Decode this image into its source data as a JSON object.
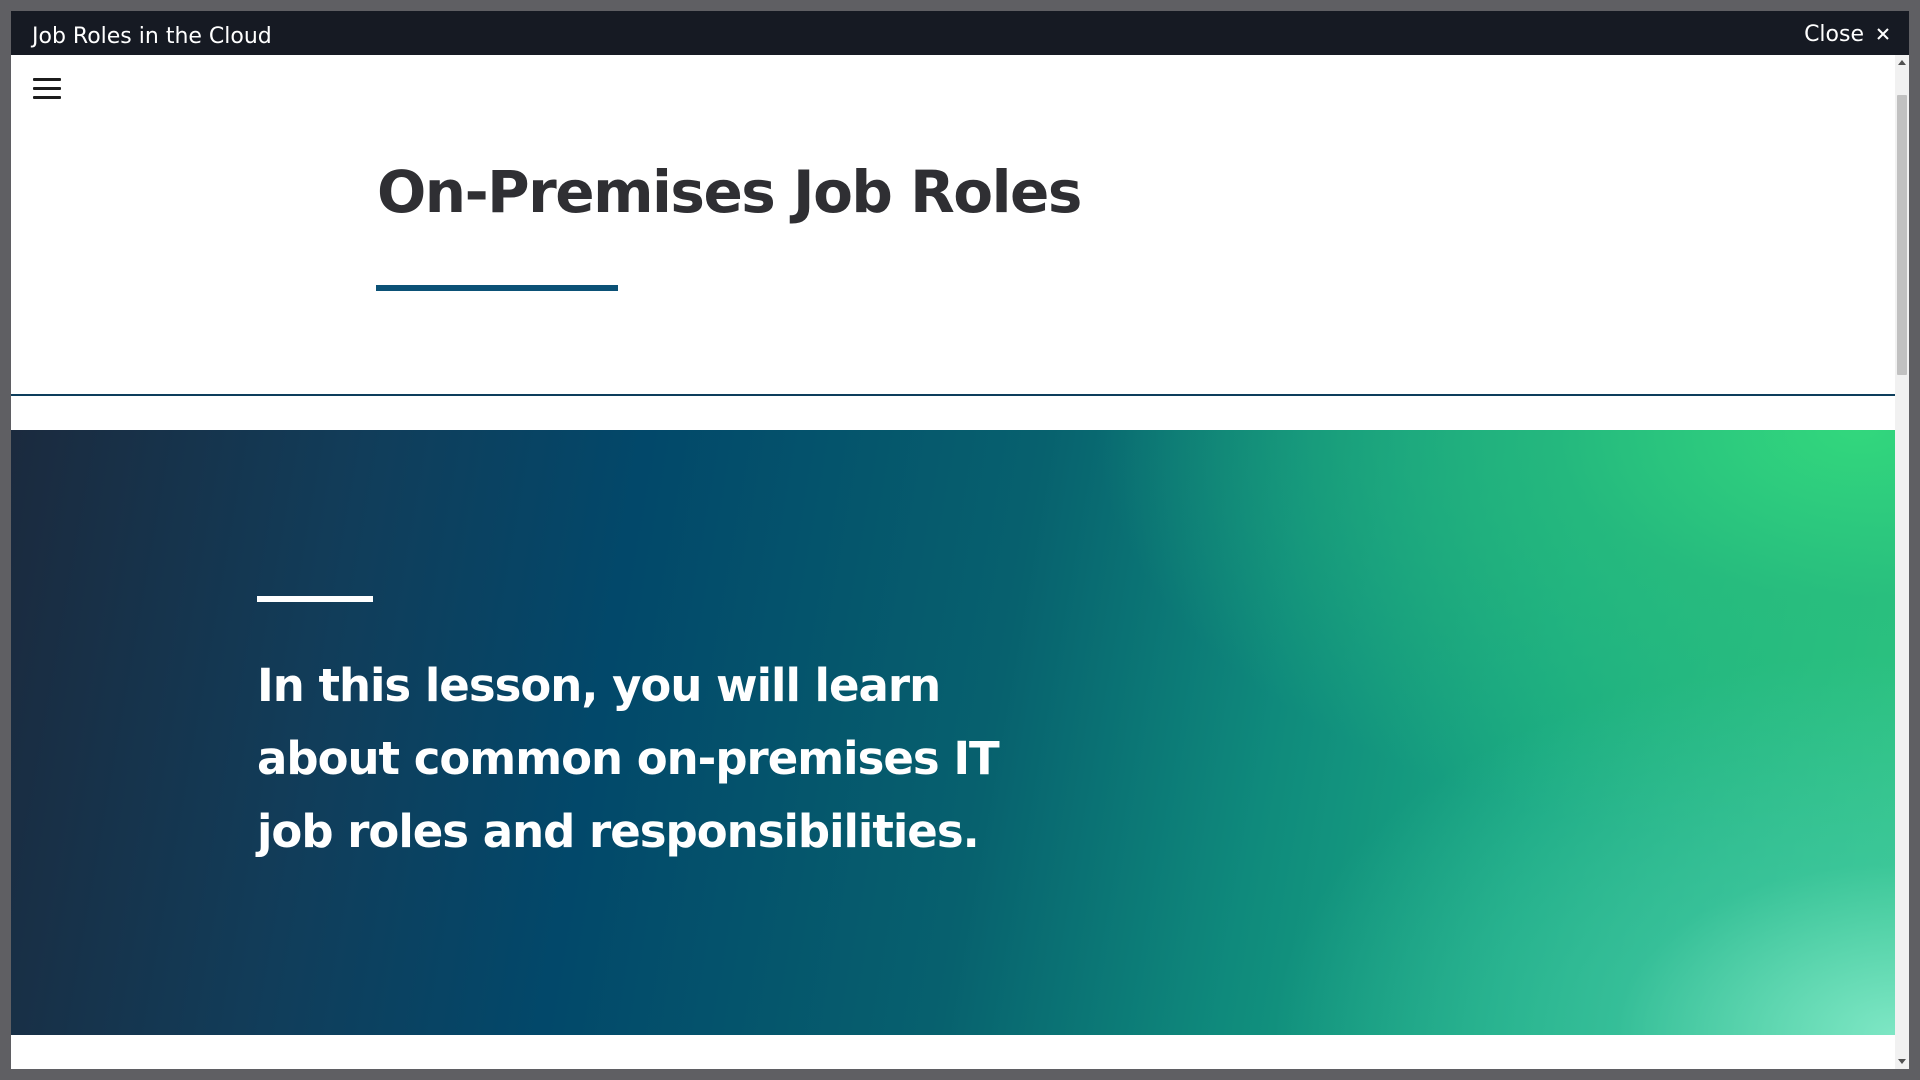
{
  "window": {
    "title": "Job Roles in the Cloud",
    "close_label": "Close"
  },
  "icons": {
    "close": "close-icon",
    "menu": "hamburger-menu-icon"
  },
  "page": {
    "title": "On-Premises Job Roles"
  },
  "hero": {
    "text": "In this lesson, you will learn about common on-premises IT job roles and responsibilities."
  },
  "colors": {
    "titlebar": "#161a23",
    "title_text": "#2f2f33",
    "accent_underline": "#0b5176",
    "hero_dark": "#1b2a3e",
    "hero_mid": "#02486a",
    "hero_green": "#31c882",
    "hero_light": "#82e8c8"
  }
}
